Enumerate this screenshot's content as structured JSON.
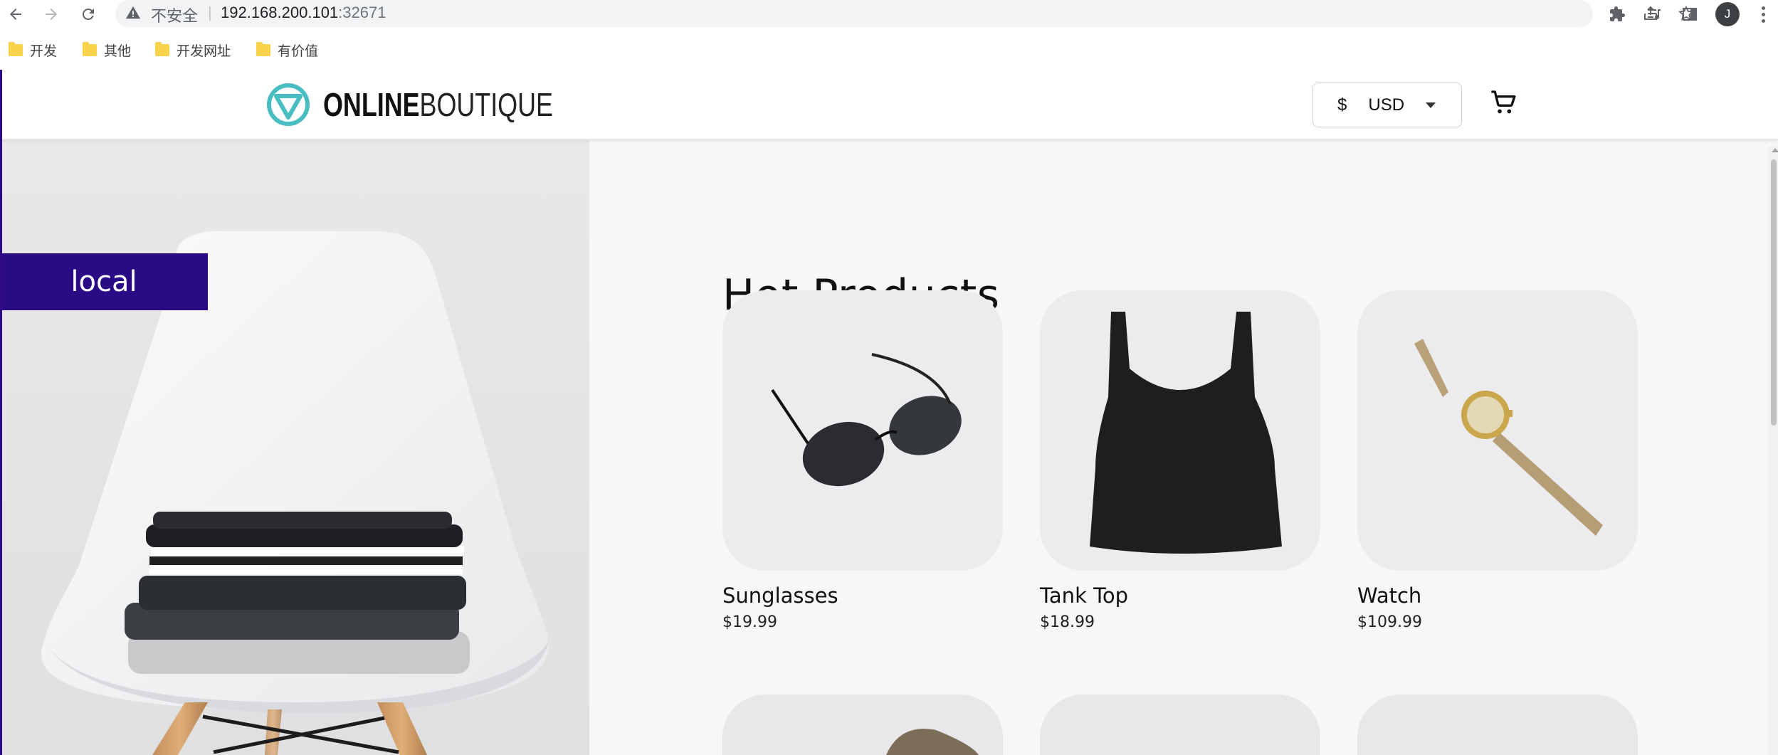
{
  "browser": {
    "omnibox": {
      "security_label": "不安全",
      "separator": "|",
      "host": "192.168.200.101",
      "port": ":32671"
    },
    "profile_initial": "J",
    "bookmarks": [
      {
        "label": "开发"
      },
      {
        "label": "其他"
      },
      {
        "label": "开发网址"
      },
      {
        "label": "有价值"
      }
    ]
  },
  "header": {
    "logo_bold": "ONLINE",
    "logo_light": "BOUTIQUE",
    "currency_symbol": "$",
    "currency_code": "USD",
    "brand_color": "#48bdc2"
  },
  "hero": {
    "badge": "local",
    "badge_color": "#2b0a86"
  },
  "main": {
    "section_title": "Hot Products",
    "products": [
      {
        "name": "Sunglasses",
        "price": "$19.99"
      },
      {
        "name": "Tank Top",
        "price": "$18.99"
      },
      {
        "name": "Watch",
        "price": "$109.99"
      }
    ]
  }
}
